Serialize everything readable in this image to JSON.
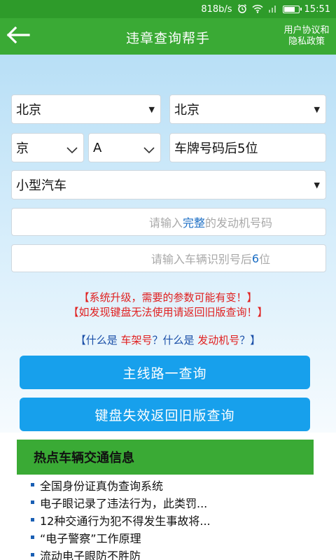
{
  "status_bar": {
    "net_speed": "818b/s",
    "time": "15:51",
    "battery_level": 0.75,
    "signal_icon": "signal-icon"
  },
  "app_bar": {
    "title": "违章查询帮手",
    "policy_line1": "用户协议和",
    "policy_line2": "隐私政策"
  },
  "form": {
    "province": "北京",
    "city": "北京",
    "plate_prefix": "京",
    "plate_letter": "A",
    "plate_suffix_placeholder": "车牌号码后5位",
    "vehicle_type": "小型汽车",
    "engine_ph_pre": "请输入",
    "engine_ph_hl": "完整",
    "engine_ph_post": "的发动机号码",
    "vin_ph_pre": "请输入车辆识别号后",
    "vin_ph_hl": "6",
    "vin_ph_post": "位"
  },
  "notices": {
    "line1": "【系统升级，需要的参数可能有变！】",
    "line2": "【如发现键盘无法使用请返回旧版查询！】"
  },
  "help": {
    "part1": "【什么是 ",
    "link1": "车架号",
    "part2": "？什么是 ",
    "link2": "发动机号",
    "part3": "？】"
  },
  "buttons": {
    "main_query": "主线路一查询",
    "old_query": "键盘失效返回旧版查询"
  },
  "hot_info": {
    "title": "热点车辆交通信息",
    "items": [
      "全国身份证真伪查询系统",
      "电子眼记录了违法行为，此类罚...",
      "12种交通行为犯不得发生事故将...",
      "“电子警察”工作原理",
      "流动电子眼防不胜防"
    ]
  }
}
